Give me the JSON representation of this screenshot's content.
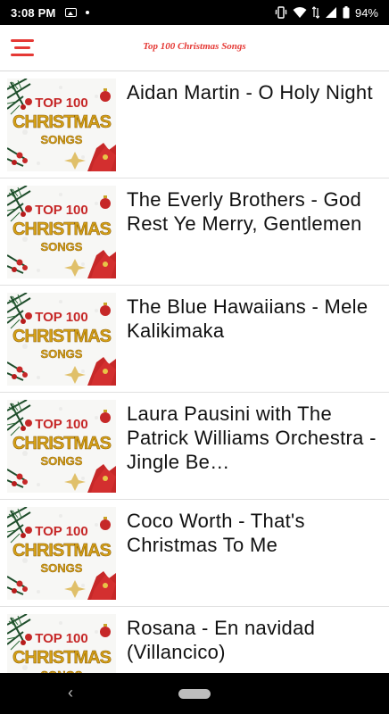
{
  "status_bar": {
    "time": "3:08 PM",
    "battery": "94%",
    "icons": [
      "photo-icon",
      "dot-icon",
      "wifi-icon",
      "signal-icon",
      "battery-icon"
    ]
  },
  "app_bar": {
    "title": "Top 100 Christmas Songs",
    "menu_icon": "hamburger-menu-icon",
    "accent_color": "#e53935"
  },
  "thumbnail": {
    "line1": "TOP 100",
    "line2": "CHRISTMAS",
    "line3": "SONGS"
  },
  "songs": [
    {
      "title": "Aidan Martin  -  O Holy Night"
    },
    {
      "title": "The Everly Brothers  -  God Rest Ye Merry, Gentlemen"
    },
    {
      "title": "The Blue Hawaiians  -  Mele Kalikimaka"
    },
    {
      "title": "Laura Pausini with The Patrick Williams Orchestra  -  Jingle Be…"
    },
    {
      "title": "Coco Worth  -  That's Christmas To Me"
    },
    {
      "title": "Rosana  -  En navidad (Villancico)"
    }
  ],
  "nav_bar": {
    "back_icon": "back-chevron-icon",
    "home_icon": "home-pill-icon"
  }
}
